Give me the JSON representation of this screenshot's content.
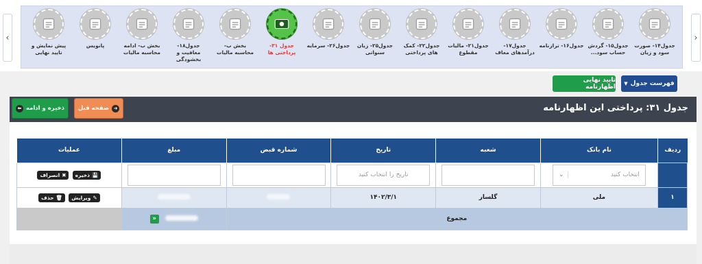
{
  "nav": {
    "left_arrow": "‹",
    "right_arrow": "›"
  },
  "tabs": [
    {
      "label": "جدول۱۴- صورت\nسود و زیان",
      "icon": "balance-scale-icon",
      "active": false
    },
    {
      "label": "جدول۱۵- گردش\nحساب سود...",
      "icon": "flowchart-icon",
      "active": false
    },
    {
      "label": "جدول۱۶- ترازنامه",
      "icon": "calculator-icon",
      "active": false
    },
    {
      "label": "جدول۱۷-\nدرآمدهای معاف",
      "icon": "coins-growth-icon",
      "active": false
    },
    {
      "label": "جدول۲۱- مالیات\nمقطوع",
      "icon": "document-percent-icon",
      "active": false
    },
    {
      "label": "جدول۲۲- کمک\nهای پرداختی",
      "icon": "money-bill-icon",
      "active": false
    },
    {
      "label": "جدول۲۵- زیان\nسنواتی",
      "icon": "chart-down-icon",
      "active": false
    },
    {
      "label": "جدول۲۶- سرمایه",
      "icon": "money-bag-icon",
      "active": false
    },
    {
      "label": "جدول ۳۱-\nپرداختی ها",
      "icon": "payment-icon",
      "active": true
    },
    {
      "label": "بخش ب-\nمحاسبه مالیات",
      "icon": "tax-icon",
      "active": false
    },
    {
      "label": "جدول۱۸-\nمعافیت و\nبخشودگی",
      "icon": "safe-icon",
      "active": false
    },
    {
      "label": "بخش ب- ادامه\nمحاسبه مالیات",
      "icon": "tax-icon",
      "active": false
    },
    {
      "label": "پانویس",
      "icon": "user-document-icon",
      "active": false
    },
    {
      "label": "پیش نمایش و\nتایید نهایی",
      "icon": "stamp-icon",
      "active": false
    }
  ],
  "actions": {
    "toc_label": "فهرست جدول",
    "confirm_label": "تایید نهایی اظهارنامه",
    "prev_label": "صفحه قبل",
    "save_continue_label": "ذخیره و ادامه"
  },
  "header": {
    "title": "جدول ۳۱: پرداختی این اظهارنامه"
  },
  "table": {
    "columns": [
      "ردیف",
      "نام بانک",
      "شعبه",
      "تاریخ",
      "شماره قبض",
      "مبلغ",
      "عملیات"
    ],
    "input_row": {
      "bank_placeholder": "انتخاب کنید",
      "date_placeholder": "تاریخ را انتخاب کنید",
      "save_label": "ذخیره",
      "cancel_label": "انصراف"
    },
    "rows": [
      {
        "index": "۱",
        "bank": "ملی",
        "branch": "گلسار",
        "date": "۱۴۰۲/۳/۱",
        "edit_label": "ویرایش",
        "delete_label": "حذف"
      }
    ],
    "sum_label": "مجموع"
  },
  "colors": {
    "header_bar": "#3d4450",
    "table_head": "#1f4f8d",
    "green": "#1f9d4b",
    "orange": "#f08d55",
    "active_tab_label": "#e53935"
  }
}
